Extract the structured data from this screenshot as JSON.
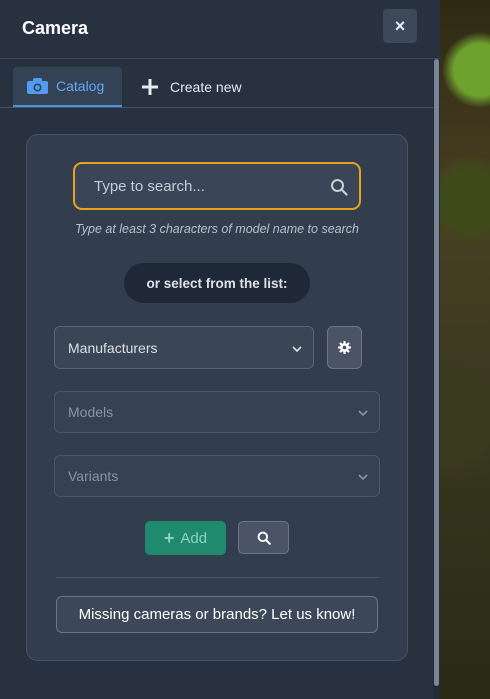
{
  "header": {
    "title": "Camera",
    "close_symbol": "×"
  },
  "tabs": [
    {
      "label": "Catalog",
      "icon": "camera-icon",
      "active": true
    },
    {
      "label": "Create new",
      "icon": "plus-icon",
      "active": false
    }
  ],
  "search": {
    "placeholder": "Type to search...",
    "value": "",
    "hint": "Type at least 3 characters of model name to search"
  },
  "select_prompt": "or select from the list:",
  "selects": {
    "manufacturers": "Manufacturers",
    "models": "Models",
    "variants": "Variants"
  },
  "actions": {
    "add_label": "Add",
    "add_symbol": "+",
    "missing_label": "Missing cameras or brands? Let us know!"
  },
  "colors": {
    "accent_tab": "#64a6f5",
    "search_focus": "#e8a21e",
    "add_button": "#1f8a6e"
  }
}
